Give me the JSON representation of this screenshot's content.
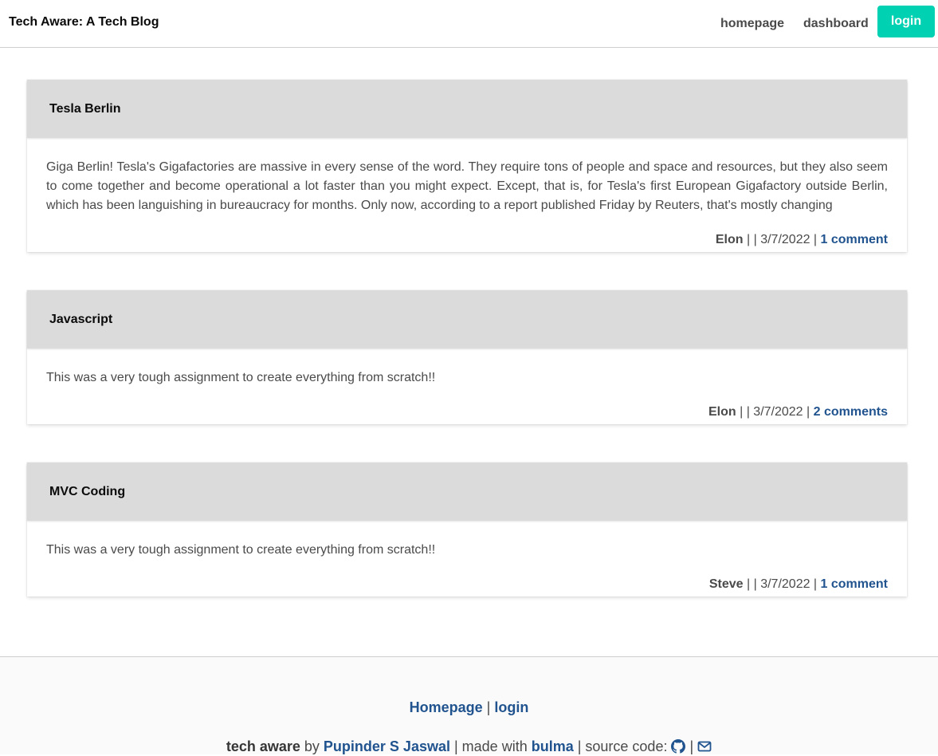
{
  "navbar": {
    "brand": "Tech Aware: A Tech Blog",
    "links": {
      "homepage": "homepage",
      "dashboard": "dashboard",
      "login": "login"
    }
  },
  "posts": [
    {
      "title": "Tesla Berlin",
      "body": "Giga Berlin! Tesla's Gigafactories are massive in every sense of the word. They require tons of people and space and resources, but they also seem to come together and become operational a lot faster than you might expect. Except, that is, for Tesla's first European Gigafactory outside Berlin, which has been languishing in bureaucracy for months. Only now, according to a report published Friday by Reuters, that's mostly changing",
      "author": "Elon",
      "separator": " | | ",
      "date": "3/7/2022",
      "date_sep": " | ",
      "comments": "1 comment"
    },
    {
      "title": "Javascript",
      "body": "This was a very tough assignment to create everything from scratch!!",
      "author": "Elon",
      "separator": " | | ",
      "date": "3/7/2022",
      "date_sep": " | ",
      "comments": "2 comments"
    },
    {
      "title": "MVC Coding",
      "body": "This was a very tough assignment to create everything from scratch!!",
      "author": "Steve",
      "separator": " | | ",
      "date": "3/7/2022",
      "date_sep": " | ",
      "comments": "1 comment"
    }
  ],
  "footer": {
    "links": {
      "homepage": "Homepage",
      "sep": " | ",
      "login": "login"
    },
    "credit": {
      "site": "tech aware",
      "by": " by ",
      "author": "Pupinder S Jaswal",
      "made_with": " | made with ",
      "framework": "bulma",
      "source_code": " | source code: ",
      "sep": " | ",
      "icons": [
        "github-icon",
        "envelope-icon"
      ]
    }
  },
  "colors": {
    "accent": "#00d1b2",
    "link": "#21548f",
    "card_header": "#dbdbdb",
    "footer_bg": "#fafafa"
  }
}
